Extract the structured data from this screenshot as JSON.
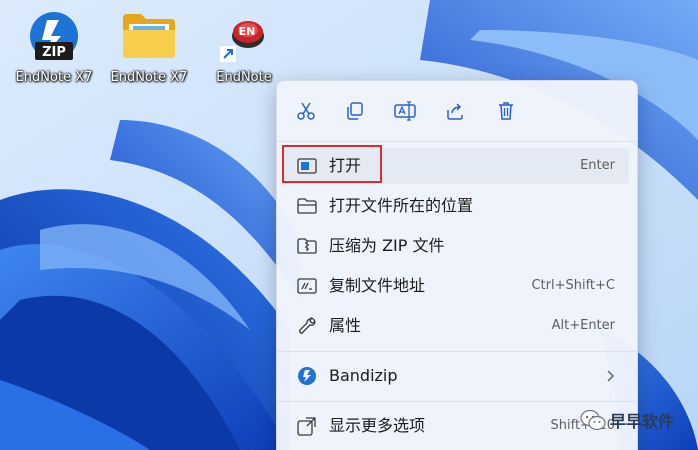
{
  "desktop": {
    "icons": [
      {
        "label": "EndNote X7",
        "icon": "bandizip-zip-icon"
      },
      {
        "label": "EndNote X7",
        "icon": "folder-icon"
      },
      {
        "label": "EndNote",
        "icon": "endnote-shortcut-icon",
        "badge": "EN"
      }
    ]
  },
  "context_menu": {
    "toolbar": [
      {
        "icon": "cut-icon",
        "name": "cut"
      },
      {
        "icon": "copy-icon",
        "name": "copy"
      },
      {
        "icon": "rename-icon",
        "name": "rename"
      },
      {
        "icon": "share-icon",
        "name": "share"
      },
      {
        "icon": "delete-icon",
        "name": "delete"
      }
    ],
    "items": [
      {
        "label": "打开",
        "shortcut": "Enter",
        "icon": "open-icon",
        "highlighted": true
      },
      {
        "label": "打开文件所在的位置",
        "shortcut": "",
        "icon": "folder-open-icon"
      },
      {
        "label": "压缩为 ZIP 文件",
        "shortcut": "",
        "icon": "zip-folder-icon"
      },
      {
        "label": "复制文件地址",
        "shortcut": "Ctrl+Shift+C",
        "icon": "copy-path-icon"
      },
      {
        "label": "属性",
        "shortcut": "Alt+Enter",
        "icon": "wrench-icon"
      },
      {
        "label": "Bandizip",
        "shortcut": "",
        "icon": "bandizip-icon",
        "submenu": true
      },
      {
        "label": "显示更多选项",
        "shortcut": "Shift+F10",
        "icon": "more-options-icon"
      }
    ]
  },
  "watermark": {
    "text": "早早软件"
  },
  "colors": {
    "highlight_border": "#e22b2b",
    "menu_bg": "#eff4fc",
    "wallpaper_blue": "#1a5fe0",
    "bandizip_blue": "#1e73d6"
  }
}
